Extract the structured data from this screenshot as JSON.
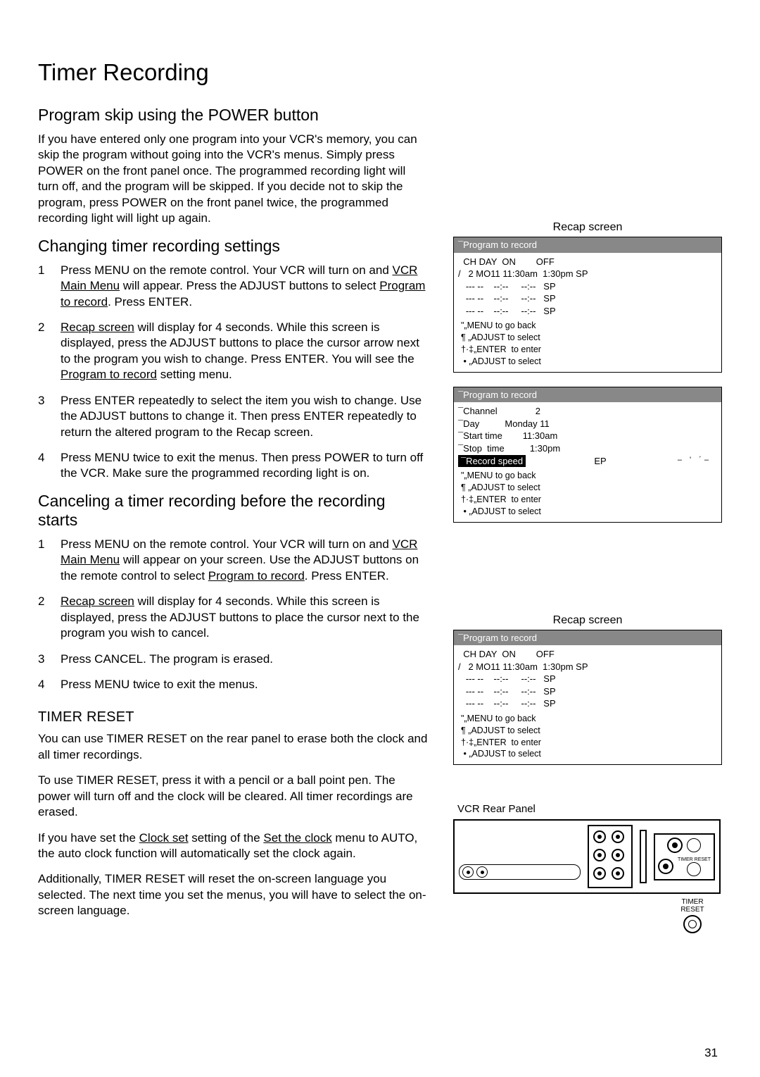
{
  "page_number": "31",
  "title": "Timer Recording",
  "s1": {
    "heading": "Program skip using the POWER button",
    "body": "If you have entered only one program into your VCR's memory, you can skip the program without going into the VCR's menus.  Simply press POWER on the front panel once.  The programmed recording light will turn off, and the program will be skipped.  If you decide not to skip the program, press POWER on the front panel twice, the programmed recording light will light up again."
  },
  "s2": {
    "heading": "Changing timer recording settings",
    "steps": [
      {
        "n": "1",
        "pre": "Press MENU on the remote control.  Your VCR will turn on and ",
        "u1": "VCR Main Menu",
        "mid": " will appear.  Press the ADJUST buttons to select ",
        "u2": "Program to record",
        "post": ".  Press ENTER."
      },
      {
        "n": "2",
        "u1": "Recap screen",
        "mid": " will display for 4 seconds.  While this screen is displayed, press the ADJUST buttons to place the cursor arrow next to the program you wish to change.  Press ENTER.  You will see the ",
        "u2": "Program to record",
        "post": " setting menu."
      },
      {
        "n": "3",
        "plain": "Press ENTER repeatedly to select the item you wish to change.  Use the ADJUST buttons to change it.  Then press ENTER repeatedly to return the altered program to the Recap screen."
      },
      {
        "n": "4",
        "plain": "Press MENU twice to exit the menus.  Then press POWER to turn off the VCR.  Make sure the programmed recording light is on."
      }
    ]
  },
  "s3": {
    "heading": "Canceling a timer recording before the recording starts",
    "steps": [
      {
        "n": "1",
        "pre": "Press MENU on the remote control.  Your VCR will turn on and ",
        "u1": "VCR Main Menu",
        "mid": " will appear on your screen.  Use the ADJUST buttons on the remote control to select ",
        "u2": "Program to record",
        "post": ".  Press ENTER."
      },
      {
        "n": "2",
        "u1": "Recap screen",
        "mid": " will display for 4 seconds.  While this screen is displayed, press the ADJUST buttons to place the cursor next to the program you wish to cancel."
      },
      {
        "n": "3",
        "plain": "Press CANCEL.  The program is erased."
      },
      {
        "n": "4",
        "plain": "Press MENU twice to exit the menus."
      }
    ]
  },
  "s4": {
    "heading": "TIMER RESET",
    "p1": "You can use TIMER RESET on the rear panel to erase both the clock and all timer recordings.",
    "p2": "To use TIMER RESET, press it with a pencil or a ball point pen.  The power will turn off and the clock will be cleared.  All timer recordings are erased.",
    "p3_pre": "If you have set the ",
    "p3_u1": "Clock set",
    "p3_mid": " setting of the ",
    "p3_u2": "Set the clock",
    "p3_post": " menu to AUTO, the auto clock function will automatically set the clock again.",
    "p4": "Additionally, TIMER RESET will reset the on-screen language you selected.  The next time you set the menus, you will have to select the on-screen language."
  },
  "right": {
    "recap_label": "Recap screen",
    "osd_title": "¯Program to record",
    "recap_header": "  CH DAY  ON        OFF",
    "recap_row1": "/   2 MO11 11:30am  1:30pm SP",
    "recap_row2": "   --- --    --:--     --:--   SP",
    "recap_row3": "   --- --    --:--     --:--   SP",
    "recap_row4": "   --- --    --:--     --:--   SP",
    "help1": "\"„MENU to go back",
    "help2": "¶ „ADJUST to select",
    "help3": "†·‡„ENTER  to enter",
    "help4": " • „ADJUST to select",
    "detail_ch": "¯Channel               2",
    "detail_day": "¯Day          Monday 11",
    "detail_start": "¯Start time        11:30am",
    "detail_stop": "¯Stop  time          1:30pm",
    "detail_speed": "¯Record speed",
    "detail_speed_val": "EP",
    "rear_label": "VCR Rear Panel",
    "reset_label_1": "TIMER",
    "reset_label_2": "RESET",
    "tiny": "TIMER RESET"
  }
}
